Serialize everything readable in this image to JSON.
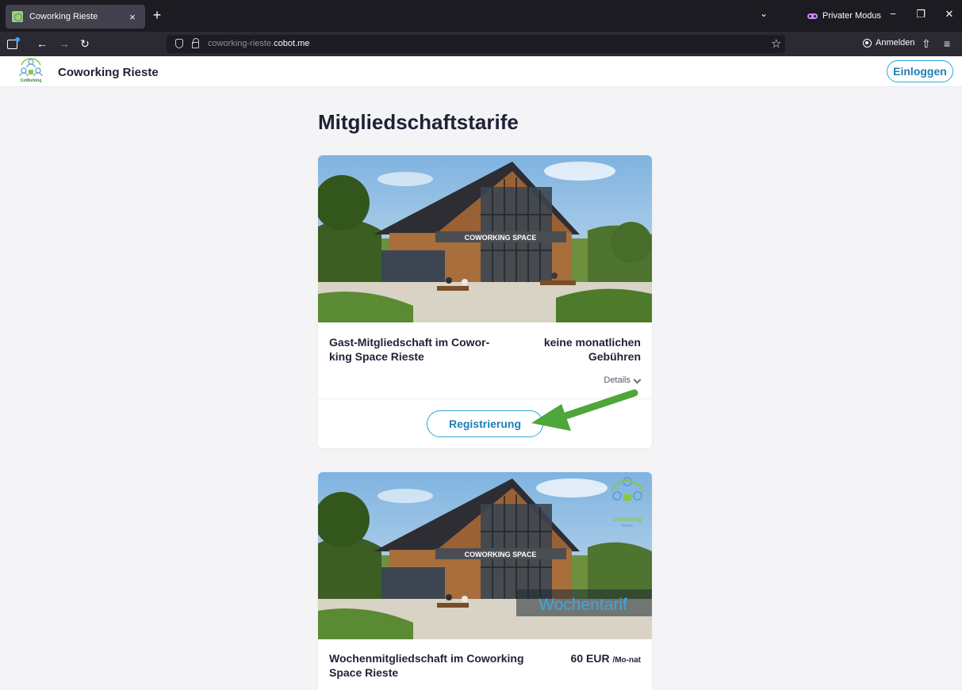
{
  "browser": {
    "tab_title": "Coworking Rieste",
    "tab_close": "×",
    "new_tab": "+",
    "list_tabs": "⌄",
    "private_label": "Privater Modus",
    "minimize": "−",
    "restore": "❐",
    "close": "✕",
    "back": "←",
    "forward": "→",
    "reload": "↻",
    "url_prefix": "coworking-rieste.",
    "url_domain": "cobot.me",
    "bookmark": "☆",
    "account_label": "Anmelden",
    "extensions": "⇧",
    "menu": "≡"
  },
  "site": {
    "title": "Coworking Rieste",
    "login_label": "Einloggen",
    "page_title": "Mitgliedschaftstarife",
    "image_sign": "COWORKING SPACE",
    "logo_text": "CoWorking",
    "logo_subtext": "Rieste"
  },
  "plans": [
    {
      "name": "Gast-Mitgliedschaft im Cowor-king Space Rieste",
      "price": "keine monatlichen Gebühren",
      "details_label": "Details",
      "register_label": "Registrierung"
    },
    {
      "name": "Wochenmitgliedschaft im Coworking Space Rieste",
      "price": "60 EUR",
      "price_unit": "/Mo-nat",
      "image_badge": "Wochentarif"
    }
  ],
  "colors": {
    "accent": "#2aa7d9",
    "arrow": "#4fa63a",
    "browser_bg": "#1c1b22",
    "private": "#c689ff"
  }
}
